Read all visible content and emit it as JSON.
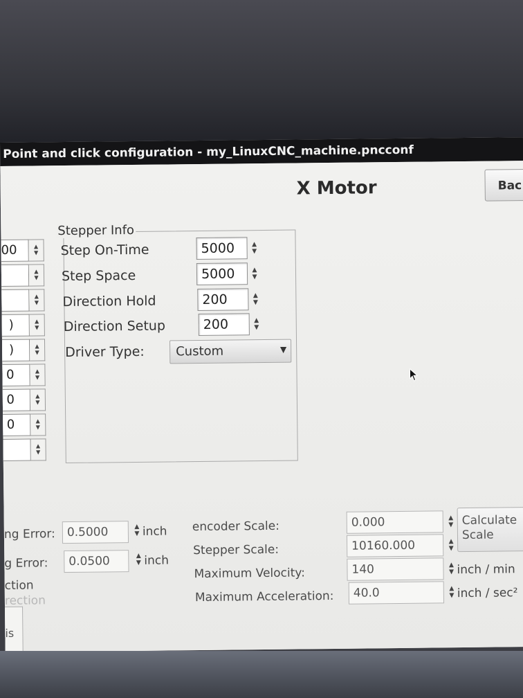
{
  "window": {
    "title": "Point and click configuration - my_LinuxCNC_machine.pncconf"
  },
  "header": {
    "page_title": "X Motor",
    "back_label": "Bac"
  },
  "left_column": {
    "values": [
      "00",
      "",
      "",
      ")",
      ")",
      "0",
      "0",
      "0",
      ""
    ]
  },
  "stepper_info": {
    "legend": "Stepper Info",
    "rows": [
      {
        "label": "Step On-Time",
        "value": "5000"
      },
      {
        "label": "Step Space",
        "value": "5000"
      },
      {
        "label": "Direction Hold",
        "value": "200"
      },
      {
        "label": "Direction Setup",
        "value": "200"
      }
    ],
    "driver_type_label": "Driver Type:",
    "driver_type_value": "Custom"
  },
  "errors": {
    "following_error_1_label": "ng Error:",
    "following_error_1_value": "0.5000",
    "following_error_1_unit": "inch",
    "following_error_2_label": "g Error:",
    "following_error_2_value": "0.0500",
    "following_error_2_unit": "inch",
    "direction_label": "ction",
    "direction_label_dim": "rection",
    "axis_tab_label": "is"
  },
  "scale": {
    "encoder_scale_label": "encoder Scale:",
    "encoder_scale_value": "0.000",
    "stepper_scale_label": "Stepper Scale:",
    "stepper_scale_value": "10160.000",
    "calculate_scale_line1": "Calculate",
    "calculate_scale_line2": "Scale",
    "max_velocity_label": "Maximum Velocity:",
    "max_velocity_value": "140",
    "max_velocity_unit": "inch / min",
    "max_accel_label": "Maximum Acceleration:",
    "max_accel_value": "40.0",
    "max_accel_unit": "inch / sec²"
  },
  "colors": {
    "titlebar": "#141416",
    "window_bg": "#ececea",
    "text": "#333333"
  }
}
